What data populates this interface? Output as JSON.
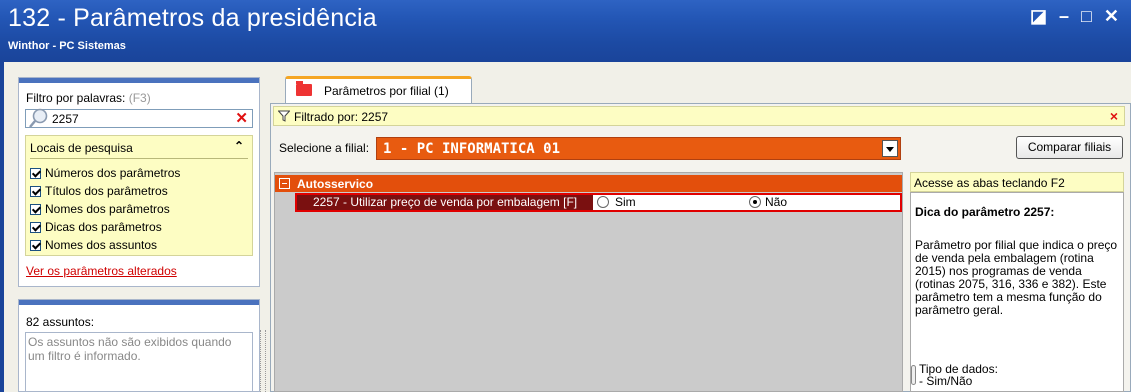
{
  "window": {
    "title": "132 - Parâmetros da presidência",
    "subtitle": "Winthor - PC Sistemas",
    "controls": [
      "◪",
      "–",
      "□",
      "✕"
    ]
  },
  "left_panel": {
    "filter_label": "Filtro por palavras:",
    "filter_hotkey": "(F3)",
    "search_value": "2257",
    "locais_title": "Locais de pesquisa",
    "locais_chevron": "⌃",
    "checkboxes": [
      {
        "label": "Números dos parâmetros",
        "checked": true
      },
      {
        "label": "Títulos dos parâmetros",
        "checked": true
      },
      {
        "label": "Nomes dos parâmetros",
        "checked": true
      },
      {
        "label": "Dicas dos parâmetros",
        "checked": true
      },
      {
        "label": "Nomes dos assuntos",
        "checked": true
      }
    ],
    "link_altered": "Ver os parâmetros alterados",
    "assuntos_count": "82 assuntos:",
    "assuntos_info": "Os assuntos não são exibidos quando um filtro é informado."
  },
  "tab": {
    "label": "Parâmetros por filial  (1)"
  },
  "filter_bar": {
    "text": "Filtrado por: 2257",
    "close": "×"
  },
  "filial": {
    "label": "Selecione a filial:",
    "value": "1 - PC INFORMATICA 01",
    "compare_button": "Comparar filiais"
  },
  "grid": {
    "group_label": "Autosservico",
    "param_label": "2257 - Utilizar preço de venda por embalagem [F]",
    "options": [
      {
        "label": "Sim",
        "selected": false
      },
      {
        "label": "Não",
        "selected": true
      }
    ]
  },
  "right_panel": {
    "hint": "Acesse as abas teclando F2",
    "title": "Dica do parâmetro 2257:",
    "description": "Parâmetro por filial que indica o preço de venda pela embalagem (rotina 2015) nos programas de venda (rotinas 2075, 316, 336 e 382). Este parâmetro tem a mesma função do parâmetro geral.",
    "tipo_label": "Tipo de dados:",
    "tipo_value": "- Sim/Não"
  },
  "colors": {
    "title_bar": "#2356b5",
    "accent_orange": "#e34f0c",
    "highlight_yellow": "#fdfdc3",
    "alert_red": "#e00000"
  }
}
